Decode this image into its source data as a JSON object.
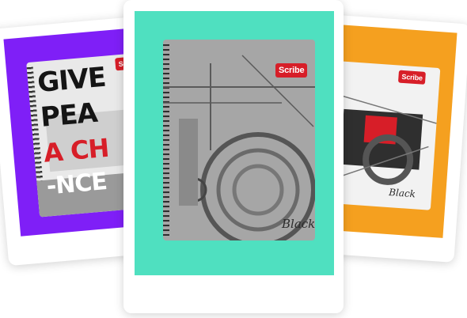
{
  "colors": {
    "left_panel": "#7f1ff7",
    "center_panel": "#4fe0c0",
    "right_panel": "#f5a01f",
    "brand_red": "#d71e28"
  },
  "left_notebook": {
    "brand": "Scribe",
    "lines": [
      "GIVE",
      "PEA",
      "A CH",
      "-NCE"
    ]
  },
  "center_notebook": {
    "brand": "Scribe",
    "signature": "Black"
  },
  "right_notebook": {
    "brand": "Scribe",
    "signature": "Black"
  }
}
